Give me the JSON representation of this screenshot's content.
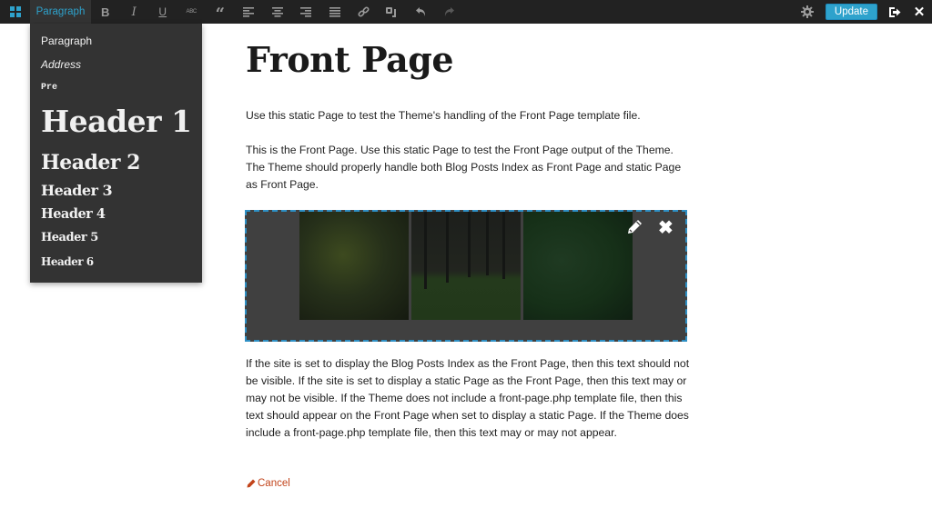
{
  "toolbar": {
    "format_label": "Paragraph",
    "buttons": {
      "bold": "B",
      "italic": "I",
      "underline": "U",
      "strikethrough": "ABC",
      "blockquote": "“"
    },
    "update_label": "Update",
    "close_glyph": "✕"
  },
  "format_menu": {
    "items": [
      "Paragraph",
      "Address",
      "Pre",
      "Header 1",
      "Header 2",
      "Header 3",
      "Header 4",
      "Header 5",
      "Header 6"
    ]
  },
  "page": {
    "title": "Front Page",
    "paragraphs": [
      "Use this static Page to test the Theme's handling of the Front Page template file.",
      "This is the Front Page. Use this static Page to test the Front Page output of the Theme. The Theme should properly handle both Blog Posts Index as Front Page and static Page as Front Page.",
      "If the site is set to display the Blog Posts Index as the Front Page, then this text should not be visible. If the site is set to display a static Page as the Front Page, then this text may or may not be visible. If the Theme does not include a front-page.php template file, then this text should appear on the Front Page when set to display a static Page. If the Theme does include a front-page.php template file, then this text may or may not appear."
    ],
    "gallery": {
      "images": [
        "fern-leaves",
        "pine-forest",
        "green-foliage"
      ],
      "remove_glyph": "✖"
    },
    "cancel_label": "Cancel"
  },
  "colors": {
    "accent": "#2ea2cc",
    "toolbar_bg": "#222222",
    "menu_bg": "#333333",
    "cancel": "#c2441b"
  }
}
